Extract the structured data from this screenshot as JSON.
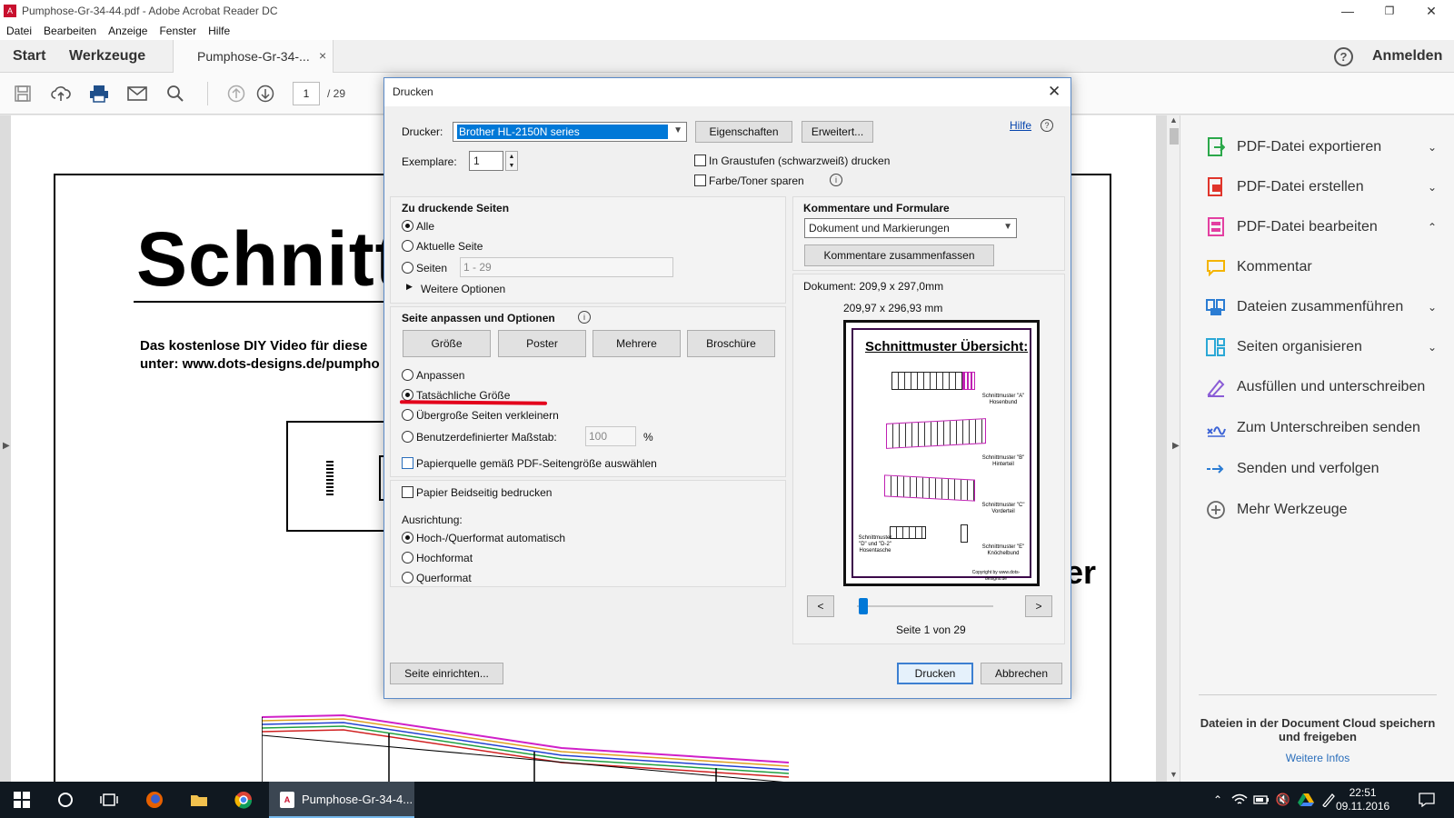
{
  "window": {
    "title": "Pumphose-Gr-34-44.pdf - Adobe Acrobat Reader DC",
    "controls": [
      "—",
      "❐",
      "✕"
    ]
  },
  "menu": [
    "Datei",
    "Bearbeiten",
    "Anzeige",
    "Fenster",
    "Hilfe"
  ],
  "tabs": {
    "start": "Start",
    "werkzeuge": "Werkzeuge",
    "doc_tab": "Pumphose-Gr-34-...",
    "close": "×",
    "help": "?",
    "anmelden": "Anmelden"
  },
  "toolbar": {
    "page_current": "1",
    "page_total": "/ 29"
  },
  "document": {
    "title": "Schnitt",
    "subtitle_line1": "Das kostenlose DIY Video für diese",
    "subtitle_line2": "unter: www.dots-designs.de/pumpho",
    "right_fragment": "er"
  },
  "right_pane": {
    "items": [
      {
        "label": "PDF-Datei exportieren",
        "icon": "export-pdf-icon",
        "color": "#2ba84a",
        "chevron": "⌄"
      },
      {
        "label": "PDF-Datei erstellen",
        "icon": "create-pdf-icon",
        "color": "#e0352b",
        "chevron": "⌄"
      },
      {
        "label": "PDF-Datei bearbeiten",
        "icon": "edit-pdf-icon",
        "color": "#e33fa1",
        "chevron": "⌃"
      },
      {
        "label": "Kommentar",
        "icon": "comment-icon",
        "color": "#f4b400",
        "chevron": ""
      },
      {
        "label": "Dateien zusammenführen",
        "icon": "combine-files-icon",
        "color": "#2b7cd3",
        "chevron": "⌄"
      },
      {
        "label": "Seiten organisieren",
        "icon": "organize-pages-icon",
        "color": "#2ba8d6",
        "chevron": "⌄"
      },
      {
        "label": "Ausfüllen und unterschreiben",
        "icon": "fill-sign-icon",
        "color": "#8a5cd6",
        "chevron": ""
      },
      {
        "label": "Zum Unterschreiben senden",
        "icon": "send-sign-icon",
        "color": "#3b63d6",
        "chevron": ""
      },
      {
        "label": "Senden und verfolgen",
        "icon": "send-track-icon",
        "color": "#2b7cd3",
        "chevron": ""
      },
      {
        "label": "Mehr Werkzeuge",
        "icon": "more-tools-icon",
        "color": "#666666",
        "chevron": ""
      }
    ],
    "footer": "Dateien in der Document Cloud speichern und freigeben",
    "footer_link": "Weitere Infos"
  },
  "dialog": {
    "title": "Drucken",
    "close": "✕",
    "printer_label": "Drucker:",
    "printer_value": "Brother HL-2150N series",
    "properties_button": "Eigenschaften",
    "advanced_button": "Erweitert...",
    "help_link": "Hilfe",
    "copies_label": "Exemplare:",
    "copies_value": "1",
    "grayscale_label": "In Graustufen (schwarzweiß) drucken",
    "save_toner_label": "Farbe/Toner sparen",
    "pages_section": {
      "heading": "Zu druckende Seiten",
      "all": "Alle",
      "current": "Aktuelle Seite",
      "pages": "Seiten",
      "pages_range": "1 - 29",
      "more_options": "Weitere Optionen"
    },
    "sizing_section": {
      "heading": "Seite anpassen und Optionen",
      "buttons": [
        "Größe",
        "Poster",
        "Mehrere",
        "Broschüre"
      ],
      "fit": "Anpassen",
      "actual_size": "Tatsächliche Größe",
      "shrink_oversized": "Übergroße Seiten verkleinern",
      "custom_scale": "Benutzerdefinierter Maßstab:",
      "custom_scale_value": "100",
      "percent": "%",
      "paper_source": "Papierquelle gemäß PDF-Seitengröße auswählen",
      "duplex": "Papier Beidseitig bedrucken",
      "orientation_label": "Ausrichtung:",
      "orientation_auto": "Hoch-/Querformat automatisch",
      "portrait": "Hochformat",
      "landscape": "Querformat"
    },
    "comments_section": {
      "heading": "Kommentare und Formulare",
      "select_value": "Dokument und Markierungen",
      "summarize_button": "Kommentare zusammenfassen"
    },
    "preview": {
      "document_size": "Dokument: 209,9 x 297,0mm",
      "paper_size": "209,97 x 296,93 mm",
      "sheet_title": "Schnittmuster Übersicht:",
      "labels": [
        "Schnittmuster \"A\" Hosenbund",
        "Schnittmuster \"B\" Hinterteil",
        "Schnittmuster \"C\" Vorderteil",
        "Schnittmuster \"D\" und \"D-2\" Hosentasche",
        "Schnittmuster \"E\" Knöchelbund",
        "Copyright by www.dots-designs.de"
      ],
      "prev": "<",
      "next": ">",
      "page_info": "Seite 1 von 29"
    },
    "page_setup_button": "Seite einrichten...",
    "print_button": "Drucken",
    "cancel_button": "Abbrechen"
  },
  "taskbar": {
    "active_app": "Pumphose-Gr-34-4...",
    "time": "22:51",
    "date": "09.11.2016"
  }
}
